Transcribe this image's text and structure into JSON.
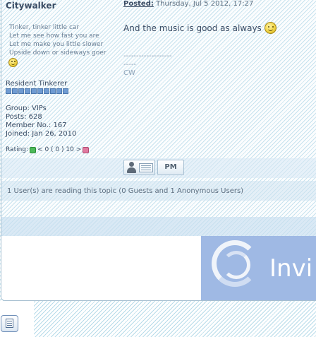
{
  "user": {
    "name": "Citywalker",
    "signature_lines": [
      "Tinker, tinker little car",
      "Let me see how fast you are",
      "Let me make you little slower",
      "Upside down or sideways goer"
    ],
    "rank": "Resident Tinkerer",
    "rank_pips": 10,
    "group": "Group: VIPs",
    "posts": "Posts: 628",
    "member_no": "Member No.: 167",
    "joined": "Joined: Jan 26, 2010",
    "rating_label": "Rating:",
    "rating_value": "< 0 ( 0 ) 10 >"
  },
  "post": {
    "posted_label": "Posted:",
    "posted_date": "Thursday, Jul 5 2012, 17:27",
    "message": "And the music is good as always",
    "sig_dashes1": "-------------------",
    "sig_dashes2": "-----",
    "sig_name": "CW"
  },
  "buttons": {
    "pm_label": "PM"
  },
  "readers_text": "1 User(s) are reading this topic (0 Guests and 1 Anonymous Users)",
  "banner_text": "Invi",
  "colors": {
    "stripe": "#b7dbe9",
    "text": "#3a4c64",
    "banner": "#9fb9e4"
  }
}
